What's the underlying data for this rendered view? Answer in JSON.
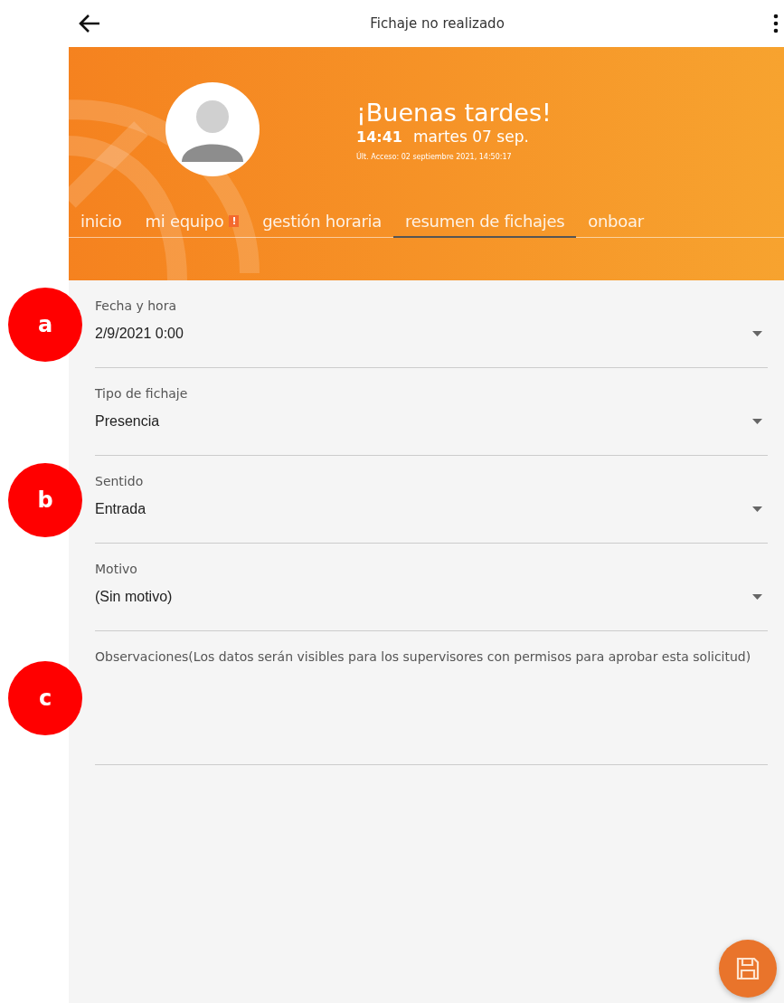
{
  "topbar": {
    "title": "Fichaje no realizado"
  },
  "banner": {
    "greeting": "¡Buenas tardes!",
    "time": "14:41",
    "date": "martes 07 sep.",
    "last_access": "Últ. Acceso: 02 septiembre 2021, 14:50:17"
  },
  "tabs": [
    {
      "label": "inicio",
      "selected": false
    },
    {
      "label": "mi equipo",
      "selected": false,
      "alert": "!"
    },
    {
      "label": "gestión horaria",
      "selected": false
    },
    {
      "label": "resumen de fichajes",
      "selected": true
    },
    {
      "label": "onboar",
      "selected": false
    }
  ],
  "fields": [
    {
      "kind": "select",
      "marker": "a",
      "label": "Fecha y hora",
      "value": "2/9/2021 0:00"
    },
    {
      "kind": "select",
      "label": "Tipo de fichaje",
      "value": "Presencia"
    },
    {
      "kind": "select",
      "marker": "b",
      "label": "Sentido",
      "value": "Entrada"
    },
    {
      "kind": "select",
      "label": "Motivo",
      "value": "(Sin motivo)"
    },
    {
      "kind": "textarea",
      "marker": "c",
      "label": "Observaciones(Los datos serán visibles para los supervisores con permisos para aprobar esta solicitud)"
    }
  ]
}
